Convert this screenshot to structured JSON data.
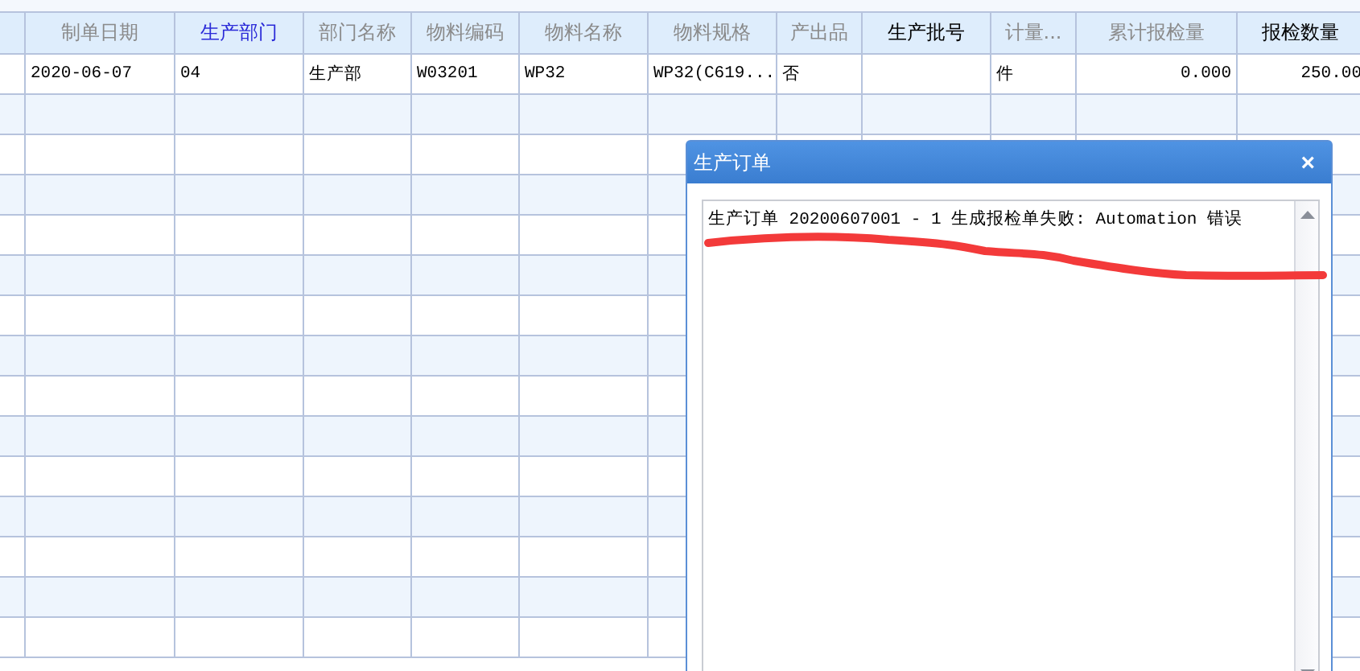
{
  "table": {
    "columns": [
      {
        "label": "制单日期",
        "kind": "muted"
      },
      {
        "label": "生产部门",
        "kind": "link"
      },
      {
        "label": "部门名称",
        "kind": "muted"
      },
      {
        "label": "物料编码",
        "kind": "muted"
      },
      {
        "label": "物料名称",
        "kind": "muted"
      },
      {
        "label": "物料规格",
        "kind": "muted"
      },
      {
        "label": "产出品",
        "kind": "muted"
      },
      {
        "label": "生产批号",
        "kind": "strong"
      },
      {
        "label": "计量...",
        "kind": "muted"
      },
      {
        "label": "累计报检量",
        "kind": "muted"
      },
      {
        "label": "报检数量",
        "kind": "strong"
      }
    ],
    "rows": [
      {
        "cells": [
          "2020-06-07",
          "04",
          "生产部",
          "W03201",
          "WP32",
          "WP32(C619...",
          "否",
          "",
          "件",
          "0.000",
          "250.00"
        ]
      }
    ]
  },
  "dialog": {
    "title": "生产订单",
    "close": "×",
    "message": "生产订单 20200607001 - 1 生成报检单失败:  Automation 错误"
  }
}
